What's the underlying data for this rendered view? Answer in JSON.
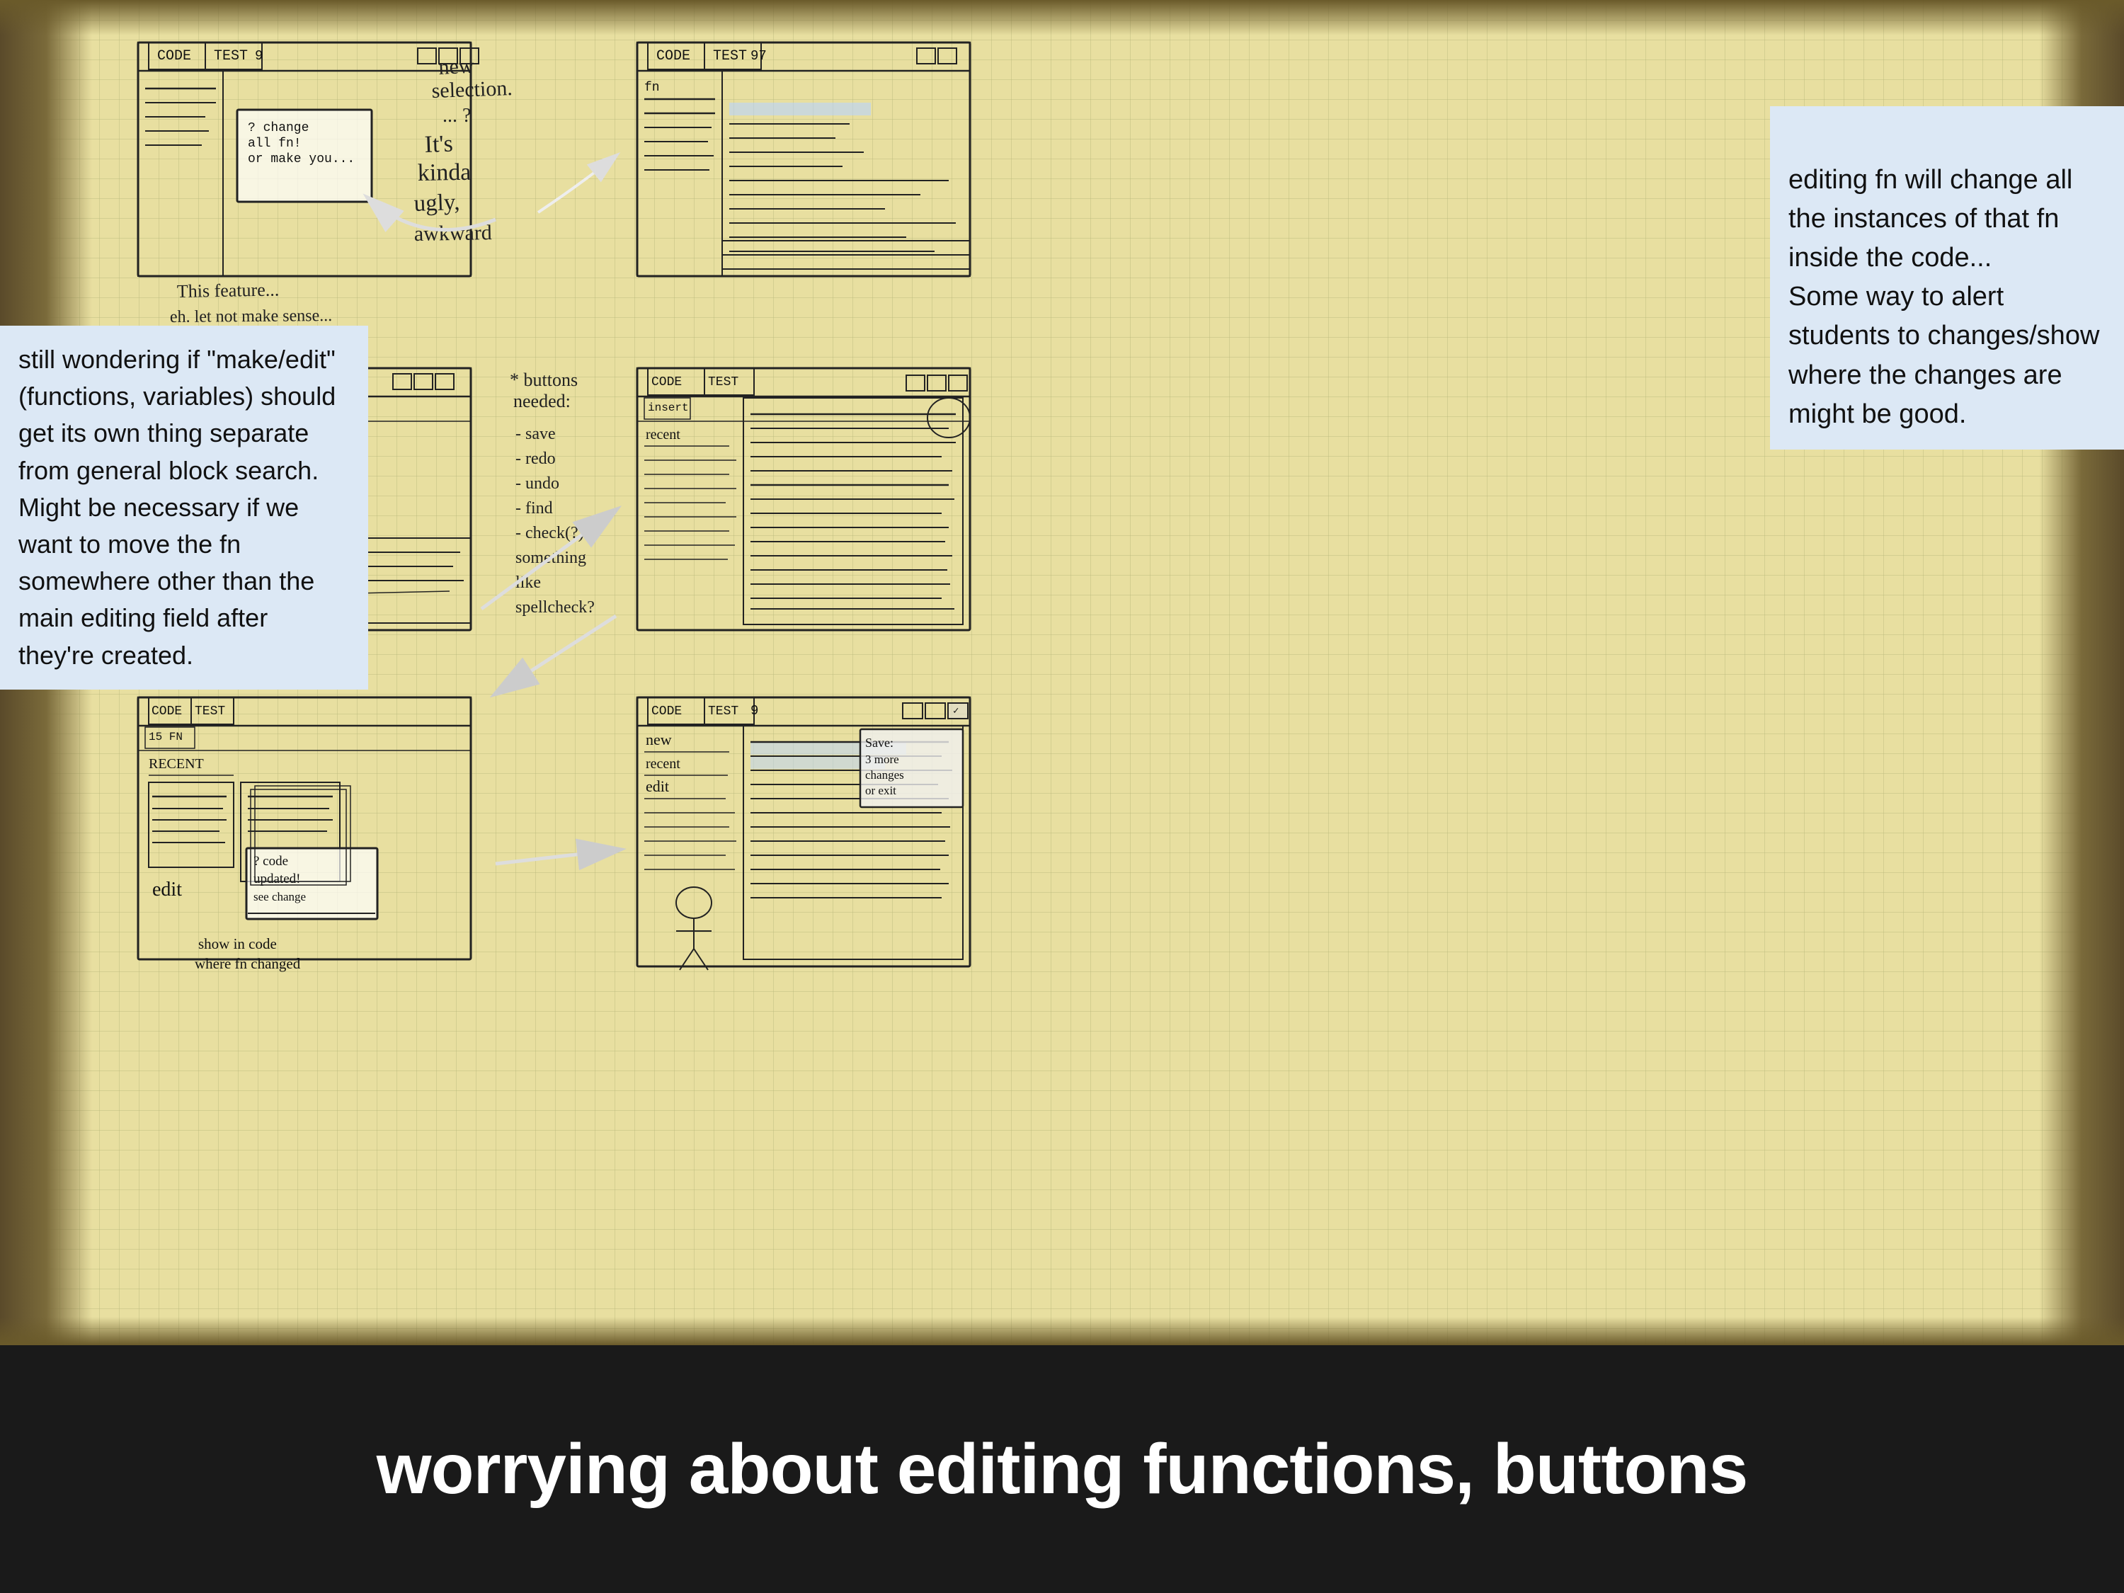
{
  "annotations": {
    "left": {
      "text": "still wondering if \"make/edit\" (functions, variables) should get its own thing separate from general block search. Might be necessary if we want to move the fn somewhere other than the main editing field after they're created."
    },
    "right": {
      "text": "editing fn will change all the instances of that fn inside the code...\nSome way to alert students to changes/show where the changes are might be good."
    }
  },
  "bottom_bar": {
    "title": "worrying about editing functions, buttons"
  },
  "sketches": {
    "handwritten_notes": [
      "new selection... ?",
      "It's kinda ugly, awkward",
      "This feature.. eh. let not make sense...",
      "buttons needed: -save -redo -undo -find -check(?) something like spellcheck?",
      "change all fn! or make you...",
      "code updated! see change",
      "show in code where fn changed"
    ]
  }
}
